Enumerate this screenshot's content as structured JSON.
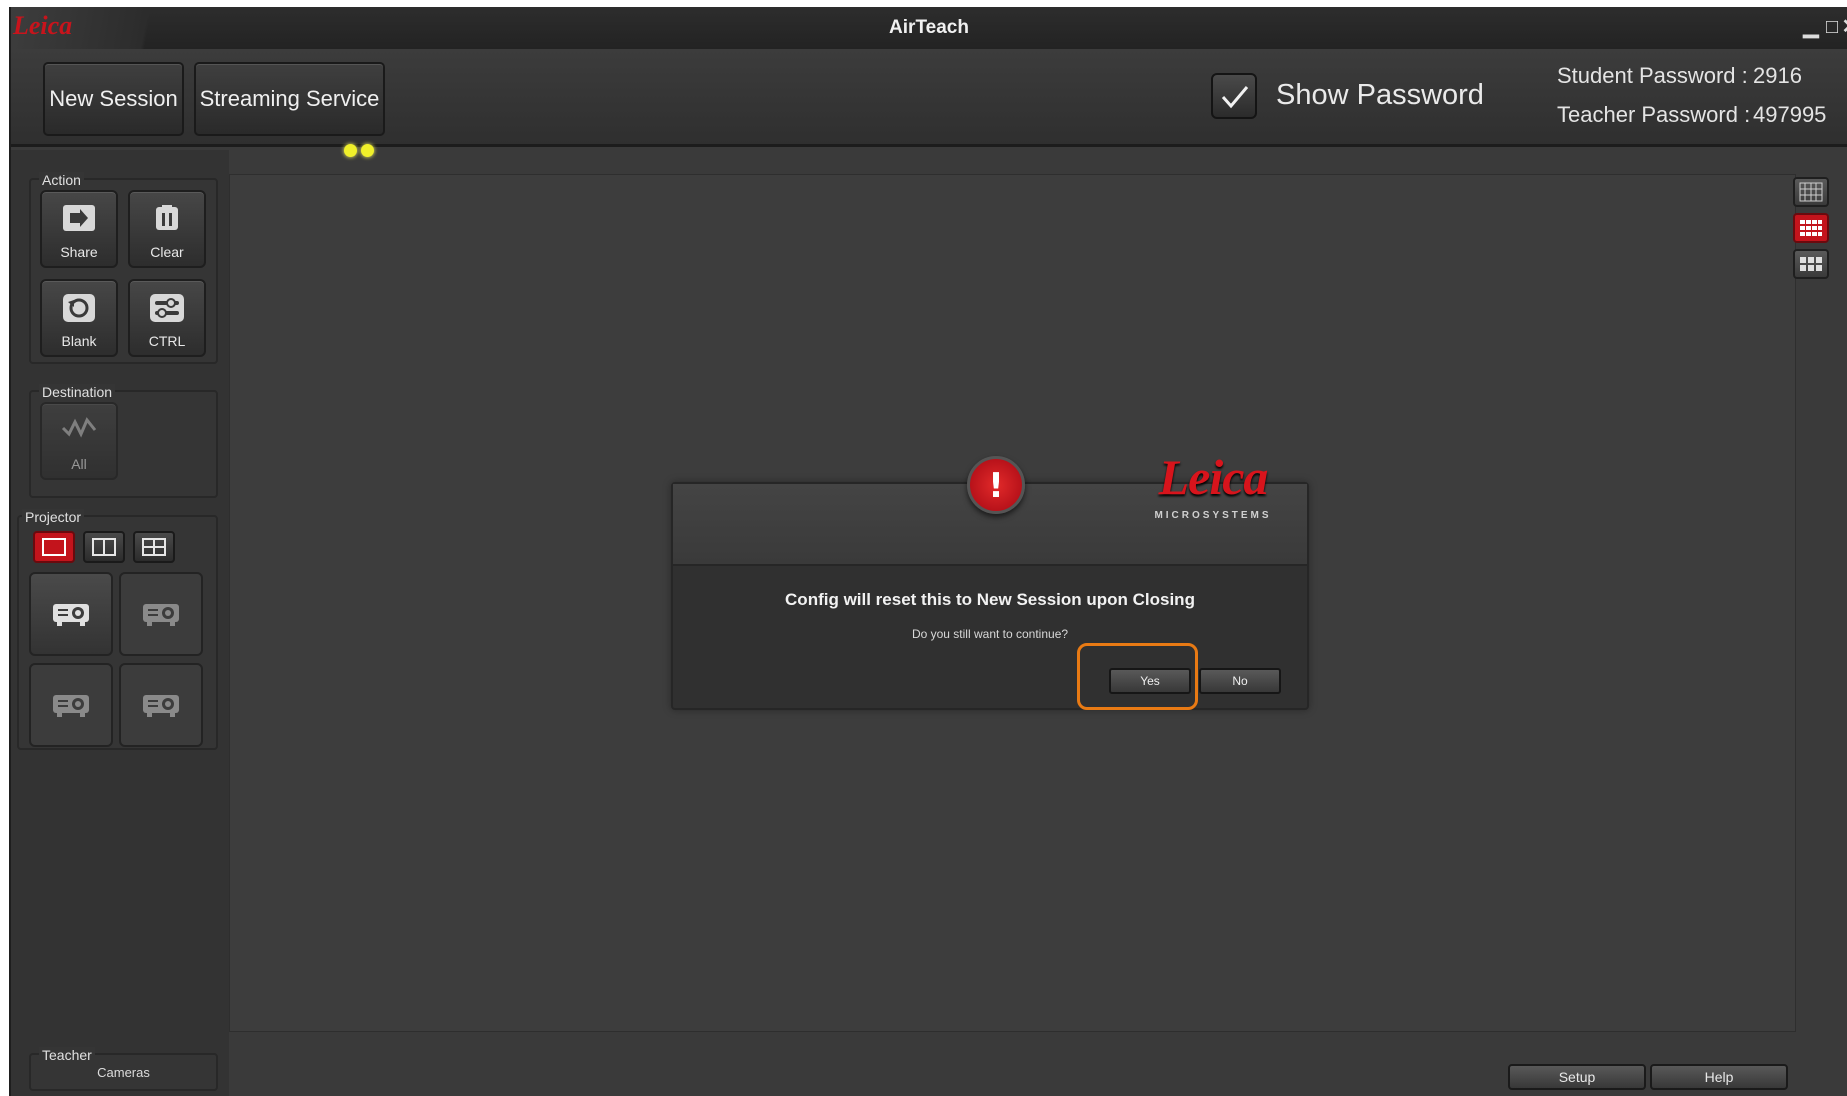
{
  "window": {
    "title": "AirTeach",
    "logo_text": "Leica",
    "minimize_glyph": "▁",
    "maximize_glyph": "□",
    "close_glyph": "✕"
  },
  "toolbar": {
    "new_session_label": "New Session",
    "streaming_service_label": "Streaming Service",
    "show_password_label": "Show Password",
    "show_password_checked": true,
    "student_password_label": "Student Password :",
    "student_password_value": "2916",
    "teacher_password_label": "Teacher Password :",
    "teacher_password_value": "497995"
  },
  "sidebar": {
    "action_title": "Action",
    "actions": [
      {
        "label": "Share",
        "icon": "share-icon"
      },
      {
        "label": "Clear",
        "icon": "trash-icon"
      },
      {
        "label": "Blank",
        "icon": "refresh-icon"
      },
      {
        "label": "CTRL",
        "icon": "sliders-icon"
      }
    ],
    "destination_title": "Destination",
    "destination_all_label": "All",
    "projector_title": "Projector",
    "teacher_title": "Teacher",
    "teacher_cameras_label": "Cameras"
  },
  "dialog": {
    "logo_word": "Leica",
    "logo_sub": "MICROSYSTEMS",
    "message": "Config will reset this to New Session upon Closing",
    "question": "Do you still want to continue?",
    "yes_label": "Yes",
    "no_label": "No"
  },
  "bottom": {
    "setup_label": "Setup",
    "help_label": "Help"
  },
  "colors": {
    "accent_red": "#c3141c",
    "highlight_orange": "#e87a14",
    "streaming_dot": "#f0f02a"
  }
}
